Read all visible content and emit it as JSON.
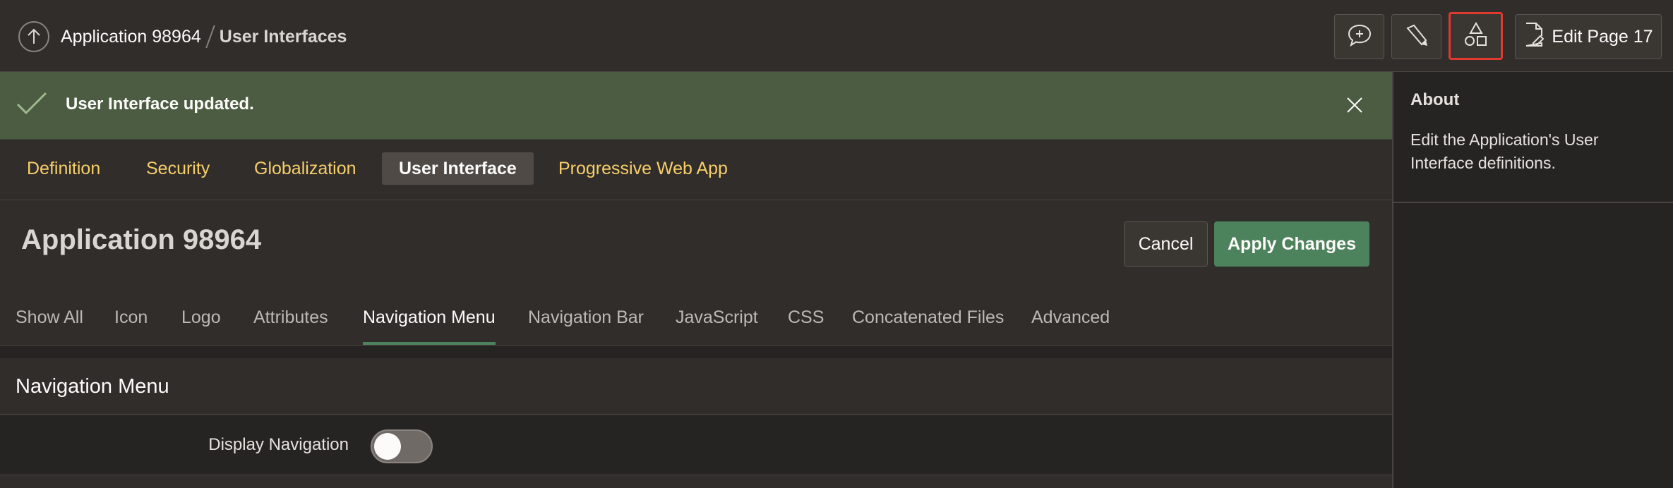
{
  "header": {
    "breadcrumb_app": "Application 98964",
    "breadcrumb_current": "User Interfaces",
    "edit_page_label": "Edit Page 17",
    "icons": [
      "up-arrow-icon",
      "feedback-icon",
      "dev-toolbar-icon",
      "shared-components-icon",
      "edit-page-icon"
    ]
  },
  "alert": {
    "message": "User Interface updated.",
    "color": "#4c5c42"
  },
  "tabs": [
    {
      "label": "Definition"
    },
    {
      "label": "Security"
    },
    {
      "label": "Globalization"
    },
    {
      "label": "User Interface"
    },
    {
      "label": "Progressive Web App"
    }
  ],
  "page": {
    "title": "Application 98964",
    "cancel_label": "Cancel",
    "apply_label": "Apply Changes"
  },
  "subtabs": [
    {
      "label": "Show All"
    },
    {
      "label": "Icon"
    },
    {
      "label": "Logo"
    },
    {
      "label": "Attributes"
    },
    {
      "label": "Navigation Menu"
    },
    {
      "label": "Navigation Bar"
    },
    {
      "label": "JavaScript"
    },
    {
      "label": "CSS"
    },
    {
      "label": "Concatenated Files"
    },
    {
      "label": "Advanced"
    }
  ],
  "region": {
    "title": "Navigation Menu",
    "display_navigation_label": "Display Navigation",
    "display_navigation_value": false
  },
  "side_panel": {
    "title": "About",
    "text": "Edit the Application's User Interface definitions."
  },
  "colors": {
    "accent_green": "#4c825c",
    "tab_link": "#f7cf6a",
    "highlight_border": "#e0392d"
  }
}
